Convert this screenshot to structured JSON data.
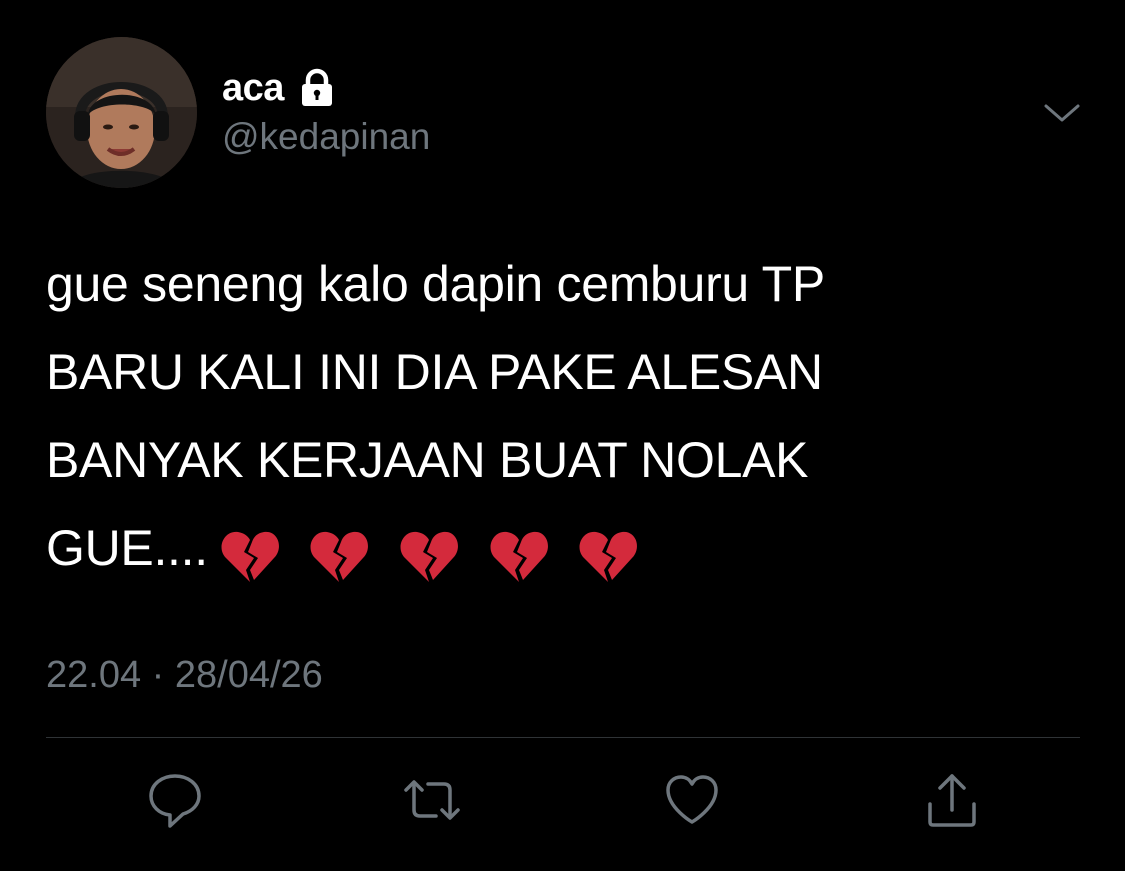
{
  "tweet": {
    "author": {
      "display_name": "aca",
      "handle": "@kedapinan",
      "protected_icon": "lock-icon",
      "avatar": "profile-photo"
    },
    "text_lines": [
      "gue seneng kalo dapin cemburu TP",
      "BARU KALI INI DIA PAKE ALESAN",
      "BANYAK KERJAAN BUAT NOLAK",
      "GUE...."
    ],
    "emoji": [
      "💔",
      "💔",
      "💔",
      "💔",
      "💔"
    ],
    "time": "22.04",
    "separator": "·",
    "date": "28/04/26"
  },
  "menu_icon": "chevron-down-icon",
  "actions": {
    "reply_icon": "reply-icon",
    "retweet_icon": "retweet-icon",
    "like_icon": "like-icon",
    "share_icon": "share-icon"
  },
  "colors": {
    "background": "#000000",
    "text_primary": "#ffffff",
    "text_secondary": "#6e767d",
    "divider": "#2f3336",
    "emoji_red": "#d42a3c"
  }
}
